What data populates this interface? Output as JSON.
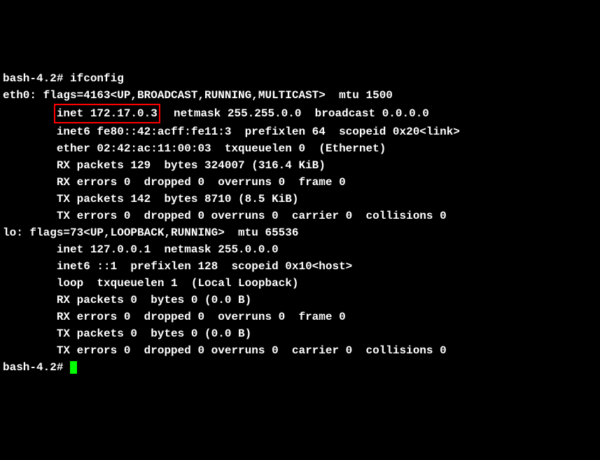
{
  "terminal": {
    "prompt": "bash-4.2# ",
    "command": "ifconfig",
    "eth0": {
      "header": "eth0: flags=4163<UP,BROADCAST,RUNNING,MULTICAST>  mtu 1500",
      "inet_highlighted": "inet 172.17.0.3",
      "inet_rest": "  netmask 255.255.0.0  broadcast 0.0.0.0",
      "inet6": "        inet6 fe80::42:acff:fe11:3  prefixlen 64  scopeid 0x20<link>",
      "ether": "        ether 02:42:ac:11:00:03  txqueuelen 0  (Ethernet)",
      "rx_packets": "        RX packets 129  bytes 324007 (316.4 KiB)",
      "rx_errors": "        RX errors 0  dropped 0  overruns 0  frame 0",
      "tx_packets": "        TX packets 142  bytes 8710 (8.5 KiB)",
      "tx_errors": "        TX errors 0  dropped 0 overruns 0  carrier 0  collisions 0"
    },
    "lo": {
      "header": "lo: flags=73<UP,LOOPBACK,RUNNING>  mtu 65536",
      "inet": "        inet 127.0.0.1  netmask 255.0.0.0",
      "inet6": "        inet6 ::1  prefixlen 128  scopeid 0x10<host>",
      "loop": "        loop  txqueuelen 1  (Local Loopback)",
      "rx_packets": "        RX packets 0  bytes 0 (0.0 B)",
      "rx_errors": "        RX errors 0  dropped 0  overruns 0  frame 0",
      "tx_packets": "        TX packets 0  bytes 0 (0.0 B)",
      "tx_errors": "        TX errors 0  dropped 0 overruns 0  carrier 0  collisions 0"
    },
    "indent8": "        ",
    "blank": ""
  }
}
